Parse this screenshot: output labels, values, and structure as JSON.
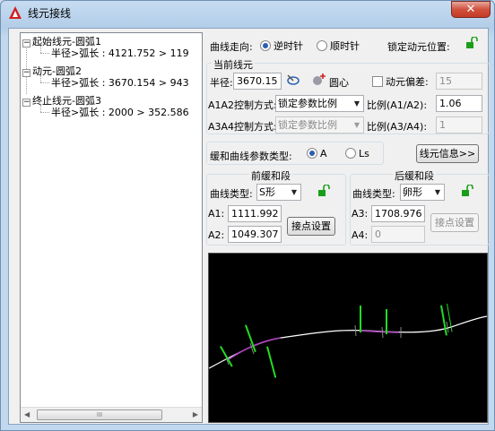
{
  "window": {
    "title": "线元接线",
    "close_label": "✕"
  },
  "tree": {
    "items": [
      {
        "label": "起始线元-圆弧1",
        "child": "半径>弧长 : 4121.752 > 119"
      },
      {
        "label": "动元-圆弧2",
        "child": "半径>弧长 : 3670.154 > 943"
      },
      {
        "label": "终止线元-圆弧3",
        "child": "半径>弧长 : 2000 > 352.586"
      }
    ],
    "scroll_thumb": "III"
  },
  "direction": {
    "label": "曲线走向:",
    "ccw_label": "逆时针",
    "cw_label": "顺时针",
    "selected": "逆时针",
    "lock_label": "锁定动元位置:"
  },
  "current": {
    "group_title": "当前线元",
    "radius_label": "半径:",
    "radius_value": "3670.15",
    "center_label": "圆心",
    "offset_label": "动元偏差:",
    "offset_value": "15",
    "a1a2_label": "A1A2控制方式:",
    "a1a2_value": "锁定参数比例",
    "ratio12_label": "比例(A1/A2):",
    "ratio12_value": "1.06",
    "a3a4_label": "A3A4控制方式:",
    "a3a4_value": "锁定参数比例",
    "ratio34_label": "比例(A3/A4):",
    "ratio34_value": "1"
  },
  "easement": {
    "type_label": "缓和曲线参数类型:",
    "a_label": "A",
    "ls_label": "Ls",
    "selected": "A",
    "info_button": "线元信息>>"
  },
  "front": {
    "group_title": "前缓和段",
    "curve_type_label": "曲线类型:",
    "curve_type_value": "S形",
    "a1_label": "A1:",
    "a1_value": "1111.992",
    "a2_label": "A2:",
    "a2_value": "1049.307",
    "button": "接点设置"
  },
  "back": {
    "group_title": "后缓和段",
    "curve_type_label": "曲线类型:",
    "curve_type_value": "卵形",
    "a3_label": "A3:",
    "a3_value": "1708.976",
    "a4_label": "A4:",
    "a4_value": "0",
    "button": "接点设置"
  },
  "colors": {
    "curve": "#ffffff",
    "spiral": "#b040c0",
    "labels": "#22dd22",
    "lock": "#1a9e1a",
    "canvas_bg": "#000000"
  }
}
